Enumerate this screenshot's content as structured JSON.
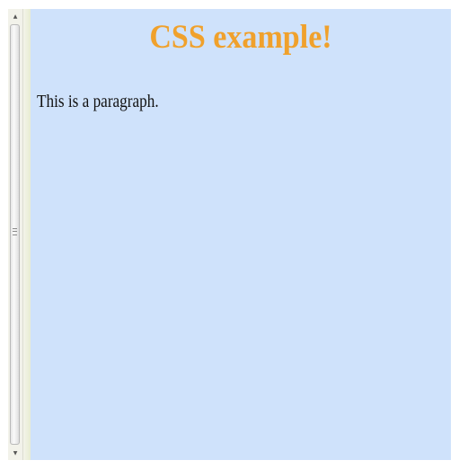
{
  "page": {
    "heading": "CSS example!",
    "paragraph": "This is a paragraph."
  },
  "colors": {
    "background": "#cfe2fb",
    "heading": "#f0a12c",
    "text": "#111111"
  },
  "icons": {
    "scroll_up": "arrow-up-icon",
    "scroll_down": "arrow-down-icon",
    "grip": "grip-icon"
  }
}
